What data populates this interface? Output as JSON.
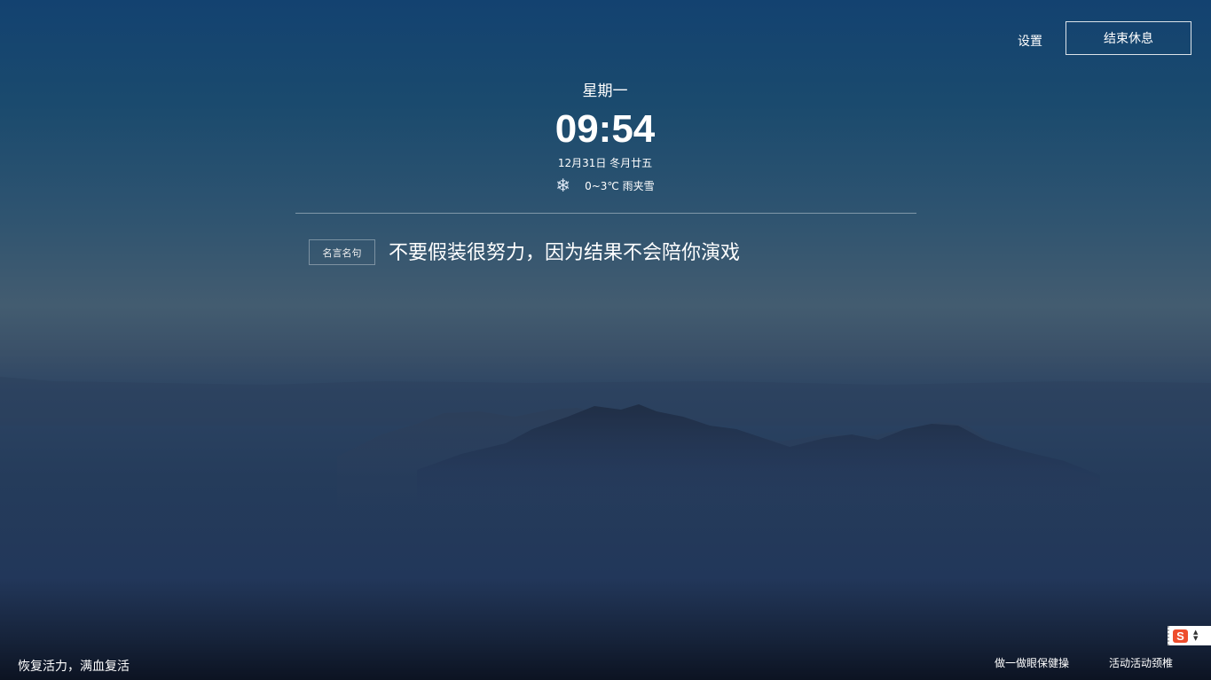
{
  "header": {
    "settings_label": "设置",
    "end_rest_label": "结束休息"
  },
  "clock": {
    "weekday": "星期一",
    "time": "09:54",
    "date": "12月31日 冬月廿五"
  },
  "weather": {
    "icon": "snowflake-icon",
    "text": "0~3℃ 雨夹雪"
  },
  "quote": {
    "tag": "名言名句",
    "text": "不要假装很努力，因为结果不会陪你演戏"
  },
  "footer": {
    "slogan": "恢复活力，满血复活",
    "eye_exercise_label": "做一做眼保健操",
    "neck_exercise_label": "活动活动颈椎"
  },
  "ime": {
    "logo": "S"
  }
}
